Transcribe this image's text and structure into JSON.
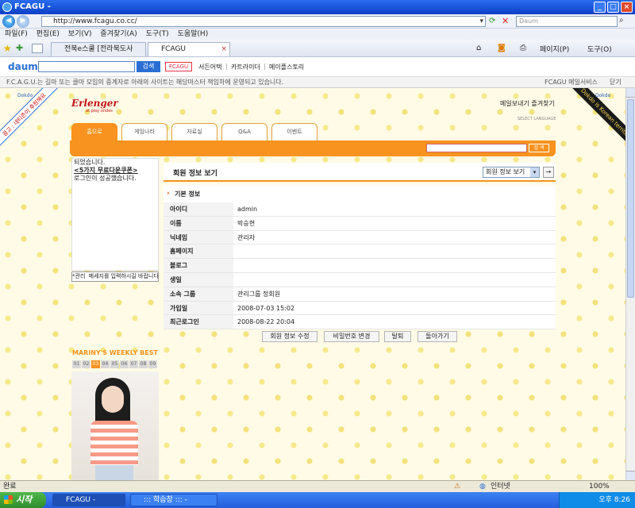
{
  "window": {
    "title": "FCAGU -"
  },
  "address": {
    "url": "http://www.fcagu.co.cc/",
    "search_placeholder": "Daum"
  },
  "menu": [
    "파일(F)",
    "편집(E)",
    "보기(V)",
    "즐겨찾기(A)",
    "도구(T)",
    "도움말(H)"
  ],
  "tabs": [
    {
      "label": "전북e스쿨 [전라북도사이..."
    },
    {
      "label": "FCAGU"
    }
  ],
  "toolbar_right": {
    "page": "페이지(P)",
    "tools": "도구(O)"
  },
  "daum_bar": {
    "logo": "daum",
    "search_button": "검색",
    "fcagu_badge": "FCAGU",
    "links": [
      "서든어택",
      "카트라이더",
      "메이플스토리"
    ]
  },
  "info_bar": {
    "text": "F.C.A.G.U.는 길마 또는 클마 모임의 중계자로 아래의 사이트는 해당마스터 책임하에 운영되고 있습니다.",
    "right_link": "FCAGU 메일서비스",
    "close_label": "닫기"
  },
  "site": {
    "logo": "Erlenger",
    "logo_sub": "at play ondes",
    "top_links": "메일보내기  즐겨찾기",
    "select_language": "SELECT LANGUAGE",
    "left_ribbon": "광고 : 네티즌이 후원해요",
    "left_ribbon_sub": "Dokdo",
    "right_ribbon": "Dokdo is Korean territory",
    "right_ribbon_sub": "Dokdo",
    "nav_tabs": [
      "홈으로",
      "게임나라",
      "자료실",
      "Q&A",
      "이벤트"
    ],
    "search_button": "검 색"
  },
  "sidebar": {
    "messages": [
      "되었습니다.",
      "<5가지 무료다운쿠폰>",
      "로그인이 성공했습니다."
    ],
    "chat_user": "*관리",
    "chat_placeholder": "메세지를 입력하시길 바랍니다.",
    "weekly_title": "MARINY'S WEEKLY BEST",
    "weekly_numbers": [
      "01",
      "02",
      "03",
      "04",
      "05",
      "06",
      "07",
      "08",
      "09"
    ],
    "weekly_selected": "03"
  },
  "member": {
    "title": "회원 정보 보기",
    "select_value": "회원 정보 보기",
    "section": "기본 정보",
    "fields": [
      {
        "label": "아이디",
        "value": "admin"
      },
      {
        "label": "이름",
        "value": "박승현"
      },
      {
        "label": "닉네임",
        "value": "관리자"
      },
      {
        "label": "홈페이지",
        "value": ""
      },
      {
        "label": "블로그",
        "value": ""
      },
      {
        "label": "생일",
        "value": ""
      },
      {
        "label": "소속 그룹",
        "value": "관리그룹 정회원"
      },
      {
        "label": "가입일",
        "value": "2008-07-03 15:02"
      },
      {
        "label": "최근로그인",
        "value": "2008-08-22 20:04"
      }
    ],
    "buttons": [
      "회원 정보 수정",
      "비밀번호 변경",
      "탈퇴",
      "돌아가기"
    ]
  },
  "status": {
    "left": "완료",
    "zone": "인터넷",
    "zoom": "100%"
  },
  "taskbar": {
    "start": "시작",
    "items": [
      "FCAGU -",
      "::: 학습창 ::: -"
    ],
    "clock": "오후 8:26"
  },
  "colors": {
    "accent": "#f7931e",
    "title_blue": "#0a3fc6",
    "pattern": "#fffbe6"
  }
}
